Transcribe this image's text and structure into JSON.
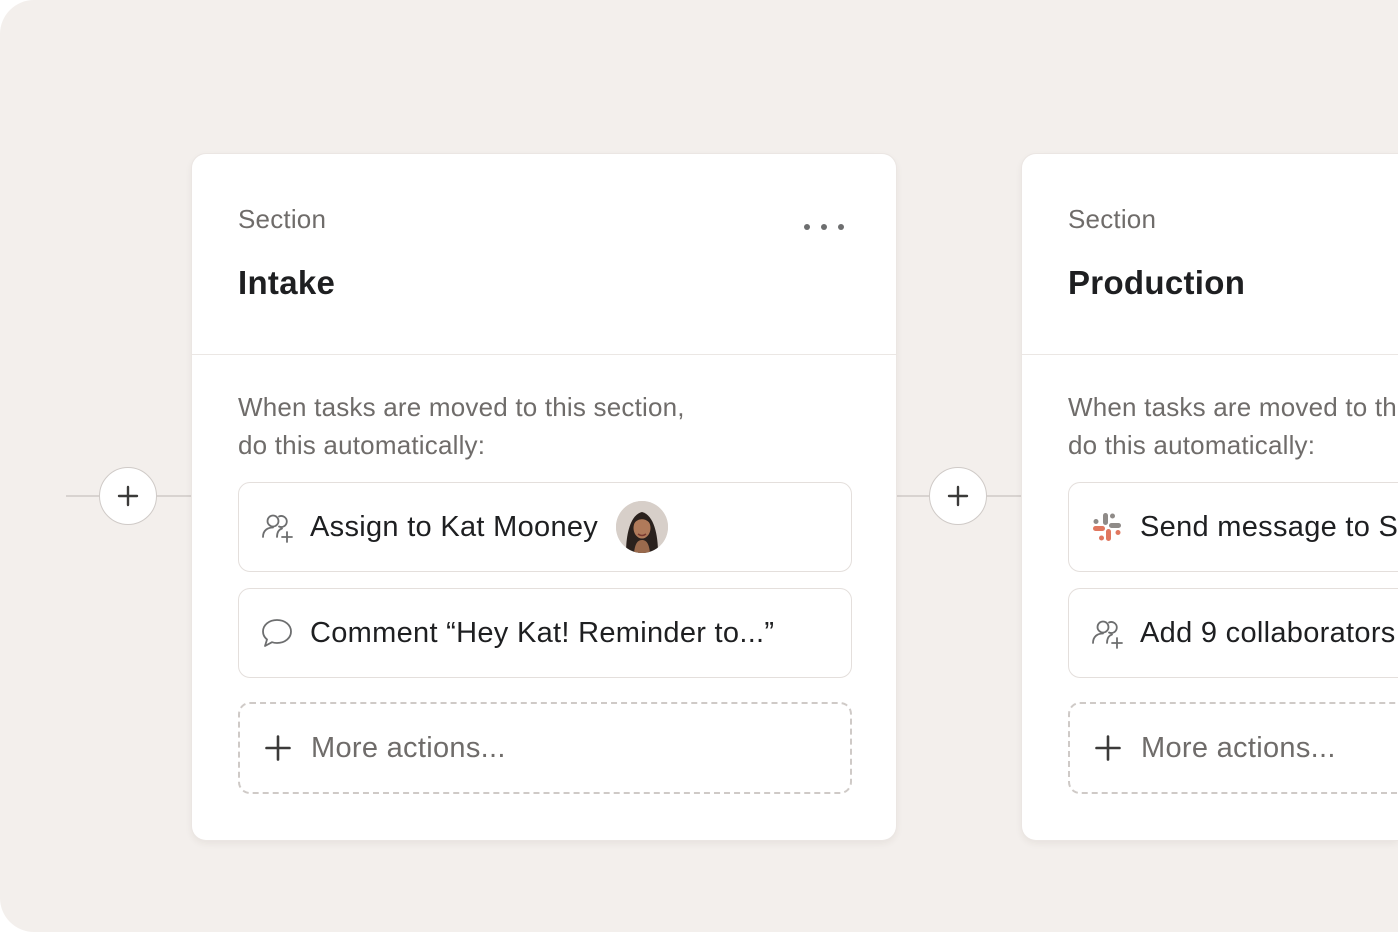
{
  "cards": [
    {
      "kicker": "Section",
      "title": "Intake",
      "rule_line1": "When tasks are moved to this section,",
      "rule_line2": "do this automatically:",
      "actions": [
        {
          "label": "Assign to Kat Mooney",
          "icon": "assign-user-icon"
        },
        {
          "label": "Comment “Hey Kat! Reminder to...”",
          "icon": "comment-bubble-icon"
        }
      ],
      "more_actions": "More actions..."
    },
    {
      "kicker": "Section",
      "title": "Production",
      "rule_line1": "When tasks are moved to this section,",
      "rule_line2": "do this automatically:",
      "actions": [
        {
          "label": "Send message to Slack",
          "icon": "slack-icon"
        },
        {
          "label": "Add 9 collaborators",
          "icon": "add-collaborators-icon"
        }
      ],
      "more_actions": "More actions..."
    }
  ],
  "colors": {
    "background": "#f3efec",
    "card": "#ffffff",
    "title": "#1e1f21",
    "muted_text": "#6f6c6a",
    "border": "#e4dfdc",
    "slack_red": "#e0775f",
    "slack_gray": "#8f8b88"
  }
}
